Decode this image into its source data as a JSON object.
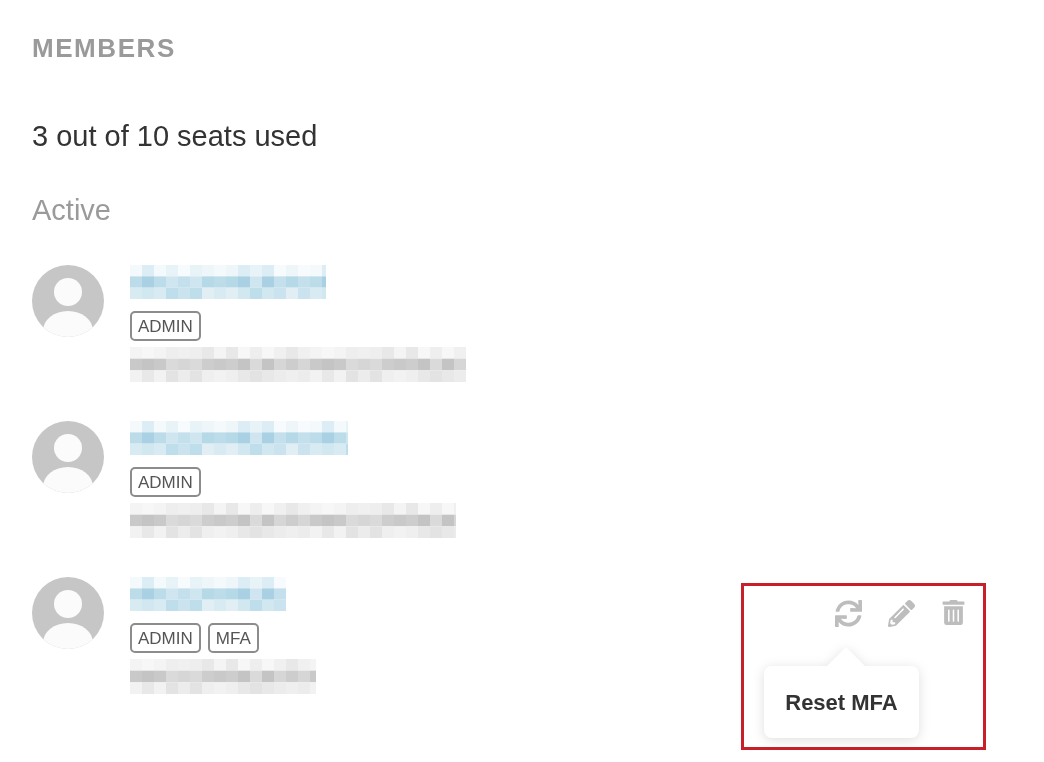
{
  "section_title": "MEMBERS",
  "seats_summary": "3 out of 10 seats used",
  "group_label": "Active",
  "members": [
    {
      "badges": [
        "ADMIN"
      ],
      "highlighted": false
    },
    {
      "badges": [
        "ADMIN"
      ],
      "highlighted": false
    },
    {
      "badges": [
        "ADMIN",
        "MFA"
      ],
      "highlighted": true,
      "actions": [
        {
          "kind": "reset",
          "tooltip": "Reset MFA"
        },
        {
          "kind": "edit"
        },
        {
          "kind": "delete"
        }
      ]
    }
  ]
}
